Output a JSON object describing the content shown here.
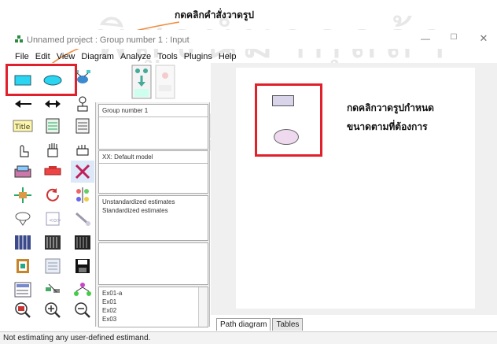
{
  "annotations": {
    "top_note": "กดคลิกคำสั่งวาดรูป",
    "right_note_line1": "กดคลิกวาดรูปกำหนด",
    "right_note_line2": "ขนาดตามที่ต้องการ"
  },
  "window": {
    "title": "Unnamed project : Group number 1 : Input",
    "min_glyph": "—",
    "max_glyph": "☐",
    "close_glyph": "✕"
  },
  "menu": [
    "File",
    "Edit",
    "View",
    "Diagram",
    "Analyze",
    "Tools",
    "Plugins",
    "Help"
  ],
  "panels": {
    "group": "Group number 1",
    "model": "XX: Default model",
    "estimates": [
      "Unstandardized estimates",
      "Standardized estimates"
    ],
    "files": [
      "Ex01-a",
      "Ex01",
      "Ex02",
      "Ex03"
    ]
  },
  "tabs": [
    "Path diagram",
    "Tables"
  ],
  "status": "Not estimating any user-defined estimand.",
  "colors": {
    "highlight": "#e0202a",
    "rect_fill": "#d9d4ea",
    "oval_fill": "#efd9ef",
    "tool_cyan": "#2bd4f0"
  },
  "tool_icons": [
    "rectangle-icon",
    "ellipse-icon",
    "indicator-icon",
    "left-arrow-icon",
    "double-arrow-icon",
    "unique-variable-icon",
    "title-icon",
    "list-variables-icon",
    "list-data-icon",
    "select-one-icon",
    "select-all-icon",
    "deselect-icon",
    "duplicate-icon",
    "move-icon",
    "erase-icon",
    "move-parameters-icon",
    "rotate-icon",
    "reflect-icon",
    "scroll-icon",
    "touch-up-icon",
    "drag-properties-icon",
    "data-files-icon",
    "analysis-properties-icon",
    "calculate-icon",
    "copy-clipboard-icon",
    "view-text-icon",
    "save-icon",
    "object-properties-icon",
    "drag-icon",
    "preserve-symmetry-icon",
    "zoom-in-area-icon",
    "zoom-in-icon",
    "zoom-out-icon"
  ]
}
